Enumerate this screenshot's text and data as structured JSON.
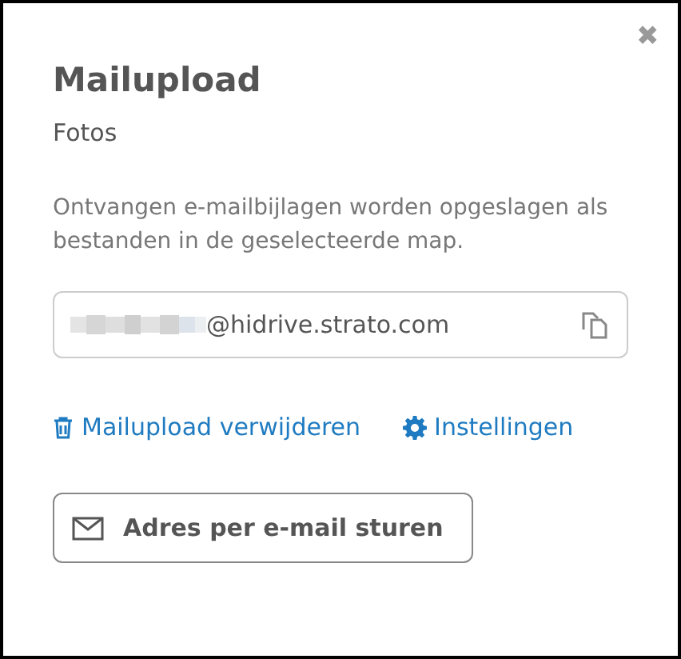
{
  "dialog": {
    "title": "Mailupload",
    "close": "✖",
    "folder": "Fotos",
    "description": "Ontvangen e-mailbijlagen worden opgeslagen als bestanden in de geselecteerde map.",
    "address_field": {
      "value": "@hidrive.strato.com"
    },
    "links": [
      {
        "kind": "delete",
        "label": "Mailupload verwijderen"
      },
      {
        "kind": "settings",
        "label": "Instellingen"
      }
    ],
    "send_button": "Adres per e-mail sturen"
  }
}
